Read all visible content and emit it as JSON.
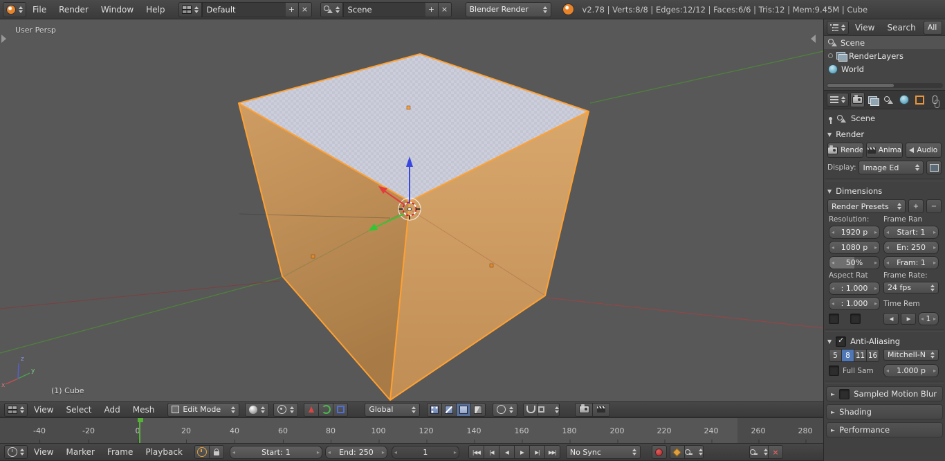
{
  "app": {
    "menus": [
      "File",
      "Render",
      "Window",
      "Help"
    ],
    "layout": "Default",
    "scene": "Scene",
    "engine": "Blender Render",
    "stats": "v2.78 | Verts:8/8 | Edges:12/12 | Faces:6/6 | Tris:12 | Mem:9.45M | Cube",
    "plus": "+",
    "minus": "−",
    "close": "×"
  },
  "viewport": {
    "view_label": "User Persp",
    "object_label": "(1) Cube",
    "axis": {
      "x": "x",
      "y": "y",
      "z": "z"
    },
    "header": {
      "menus": [
        "View",
        "Select",
        "Add",
        "Mesh"
      ],
      "mode": "Edit Mode",
      "orientation": "Global"
    }
  },
  "outliner": {
    "menu_view": "View",
    "menu_search": "Search",
    "scope": "All Sc",
    "items": [
      {
        "label": "Scene"
      },
      {
        "label": "RenderLayers"
      },
      {
        "label": "World"
      }
    ]
  },
  "properties": {
    "context": "Scene",
    "render": {
      "title": "Render",
      "btn_render": "Rende",
      "btn_anim": "Anima",
      "btn_audio": "Audio",
      "display_label": "Display:",
      "display_value": "Image Ed"
    },
    "dimensions": {
      "title": "Dimensions",
      "presets": "Render Presets",
      "col_resolution": "Resolution:",
      "col_frame_range": "Frame Ran",
      "res_x": "1920 p",
      "res_y": "1080 p",
      "res_scale": "50%",
      "frame_start": "Start: 1",
      "frame_end": "En: 250",
      "frame_current": "Fram: 1",
      "col_aspect": "Aspect Rat",
      "col_frame_rate": "Frame Rate:",
      "aspect_x": ": 1.000",
      "aspect_y": ": 1.000",
      "fps": "24 fps",
      "time_remap": "Time Rem",
      "frame_step": "1"
    },
    "antialiasing": {
      "title": "Anti-Aliasing",
      "samples": [
        "5",
        "8",
        "11",
        "16"
      ],
      "filter": "Mitchell-N",
      "full_sample": "Full Sam",
      "size": "1.000 p"
    },
    "sections": {
      "motion_blur": "Sampled Motion Blur",
      "shading": "Shading",
      "performance": "Performance"
    }
  },
  "timeline": {
    "menus": [
      "View",
      "Marker",
      "Frame",
      "Playback"
    ],
    "start_label": "Start:",
    "start_value": "1",
    "end_label": "End:",
    "end_value": "250",
    "current": "1",
    "sync": "No Sync",
    "ruler": [
      "-40",
      "-20",
      "0",
      "20",
      "40",
      "60",
      "80",
      "100",
      "120",
      "140",
      "160",
      "180",
      "200",
      "220",
      "240",
      "260",
      "280"
    ]
  }
}
